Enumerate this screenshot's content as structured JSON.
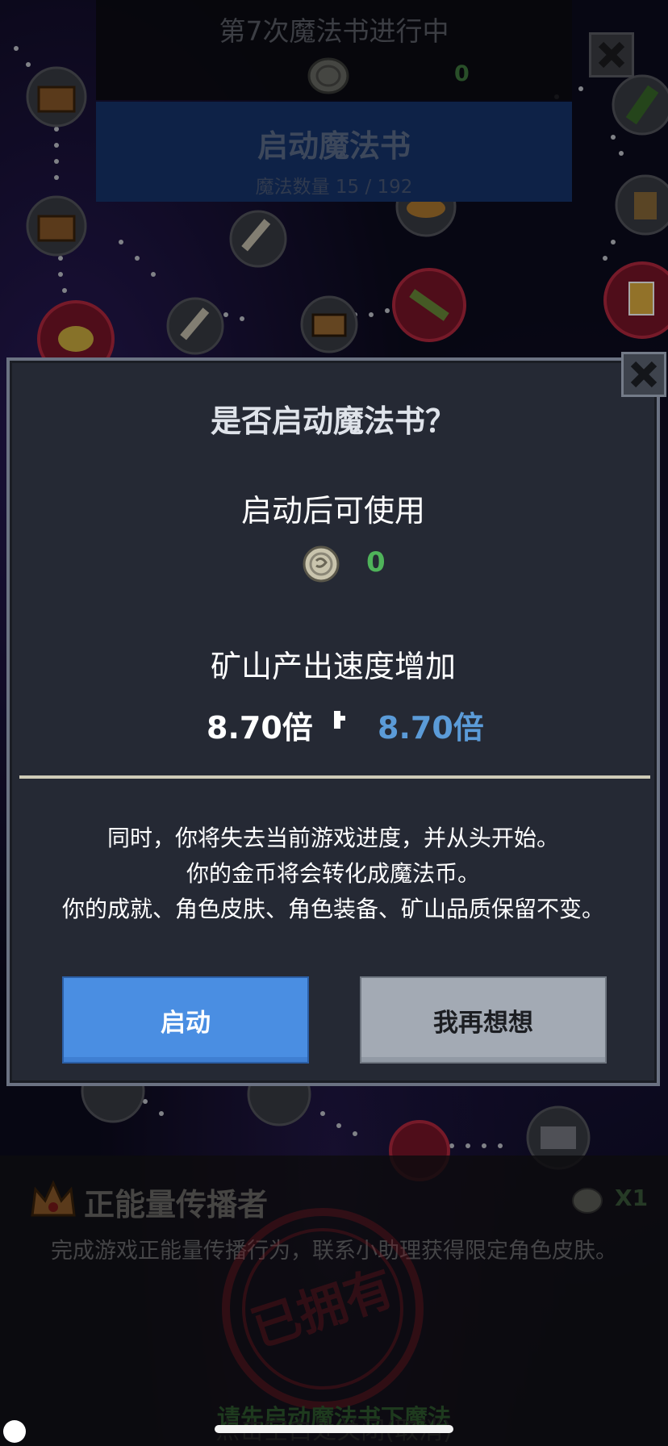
{
  "top_panel": {
    "title": "第7次魔法书进行中",
    "coin_value": "0",
    "start_banner_label": "启动魔法书",
    "magic_count": "魔法数量 15 / 192"
  },
  "dialog": {
    "title": "是否启动魔法书？",
    "subtitle": "启动后可使用",
    "coin_value": "0",
    "mine_label": "矿山产出速度增加",
    "speed_from": "8.70倍",
    "speed_to": "8.70倍",
    "warnings": [
      "同时，你将失去当前游戏进度，并从头开始。",
      "你的金币将会转化成魔法币。",
      "你的成就、角色皮肤、角色装备、矿山品质保留不变。"
    ],
    "confirm_label": "启动",
    "cancel_label": "我再想想"
  },
  "achievement": {
    "title": "正能量传播者",
    "reward": "X1",
    "description": "完成游戏正能量传播行为，联系小助理获得限定角色皮肤。",
    "stamp": "已拥有"
  },
  "bottom": {
    "green_hint": "请先启动魔法书下魔法",
    "close_hint": "点击空白处关闭(取消)"
  },
  "colors": {
    "confirm_button": "#4a8ee2",
    "cancel_button": "#a3aab4",
    "dialog_bg": "#252934",
    "coin_value_green": "#4fb35a",
    "speed_to_blue": "#5b9bd8"
  },
  "icons": [
    "magic-coin-icon",
    "close-icon",
    "arrow-right-icon",
    "crown-icon",
    "sword-icon",
    "chest-icon",
    "beer-icon",
    "bottle-icon",
    "skewer-icon",
    "miner-helmet-icon"
  ]
}
